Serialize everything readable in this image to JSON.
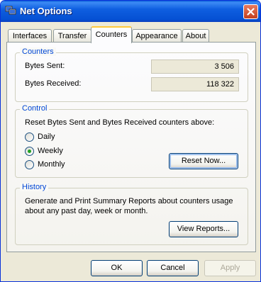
{
  "window": {
    "title": "Net Options"
  },
  "tabs": [
    {
      "label": "Interfaces"
    },
    {
      "label": "Transfer"
    },
    {
      "label": "Counters"
    },
    {
      "label": "Appearance"
    },
    {
      "label": "About"
    }
  ],
  "counters": {
    "title": "Counters",
    "bytes_sent_label": "Bytes Sent:",
    "bytes_sent_value": "3 506",
    "bytes_received_label": "Bytes Received:",
    "bytes_received_value": "118 322"
  },
  "control": {
    "title": "Control",
    "description": "Reset Bytes Sent and Bytes Received counters above:",
    "options": [
      {
        "label": "Daily",
        "selected": false
      },
      {
        "label": "Weekly",
        "selected": true
      },
      {
        "label": "Monthly",
        "selected": false
      }
    ],
    "reset_button": "Reset Now..."
  },
  "history": {
    "title": "History",
    "description_line1": "Generate and Print Summary Reports about counters usage",
    "description_line2": "about any past day, week or month.",
    "view_button": "View Reports..."
  },
  "footer": {
    "ok": "OK",
    "cancel": "Cancel",
    "apply": "Apply"
  },
  "colors": {
    "title_bar": "#0550D3",
    "group_title": "#0046D5",
    "active_tab": "#FFC83C",
    "radio_selected": "#21A121"
  }
}
